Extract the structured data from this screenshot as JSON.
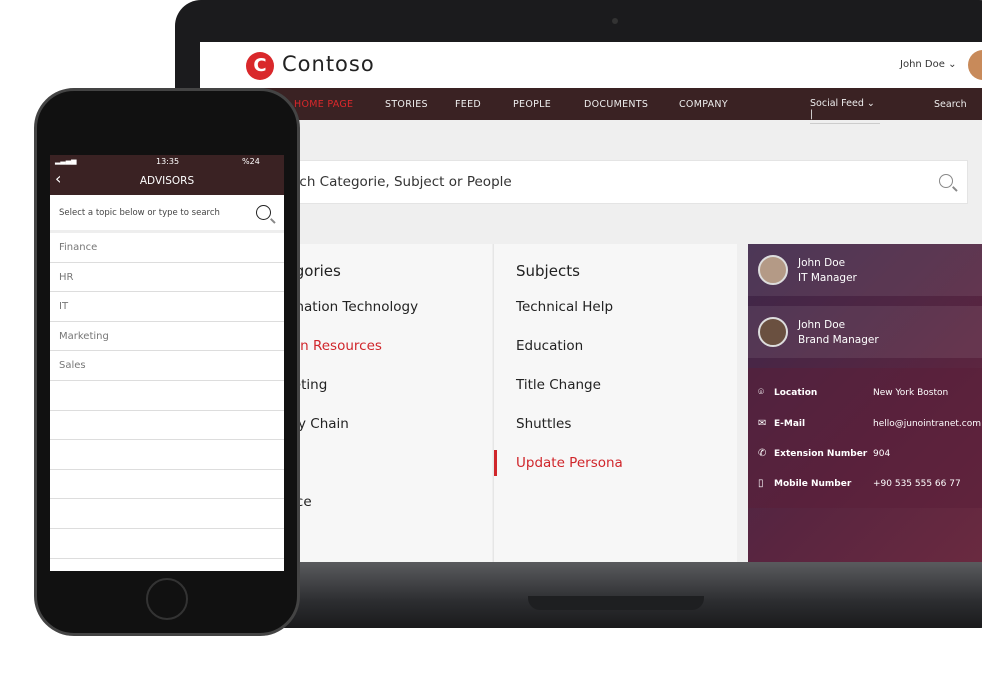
{
  "header": {
    "brand": "Contoso",
    "logo_letter": "C",
    "user": "John Doe ⌄"
  },
  "nav": {
    "items": [
      "HOME PAGE",
      "STORIES",
      "FEED",
      "PEOPLE",
      "DOCUMENTS",
      "COMPANY"
    ],
    "active": "HOME PAGE",
    "social_feed": "Social Feed ⌄ |",
    "search": "Search"
  },
  "search": {
    "placeholder": "Search Categorie, Subject or People"
  },
  "categories": {
    "title": "Categories",
    "items": [
      "Information Technology",
      "Human Resources",
      "Marketing",
      "Supply Chain",
      "Finance"
    ],
    "active": "Human Resources"
  },
  "subjects": {
    "title": "Subjects",
    "items": [
      "Technical Help",
      "Education",
      "Title Change",
      "Shuttles",
      "Update Persona"
    ],
    "active": "Update Persona"
  },
  "profiles": [
    {
      "name": "John Doe",
      "role": "IT Manager"
    },
    {
      "name": "John Doe",
      "role": "Brand Manager"
    }
  ],
  "details": [
    {
      "icon": "location-pin-icon",
      "label": "Location",
      "value": "New York Boston"
    },
    {
      "icon": "mail-icon",
      "label": "E-Mail",
      "value": "hello@junointranet.com"
    },
    {
      "icon": "phone-icon",
      "label": "Extension Number",
      "value": "904"
    },
    {
      "icon": "mobile-icon",
      "label": "Mobile Number",
      "value": "+90 535 555 66 77"
    }
  ],
  "phone": {
    "time": "13:35",
    "battery": "%24",
    "title": "ADVISORS",
    "search_placeholder": "Select a topic below or type to search",
    "topics": [
      "Finance",
      "HR",
      "IT",
      "Marketing",
      "Sales"
    ]
  },
  "colors": {
    "accent": "#d9282b",
    "nav": "#3a2223"
  }
}
